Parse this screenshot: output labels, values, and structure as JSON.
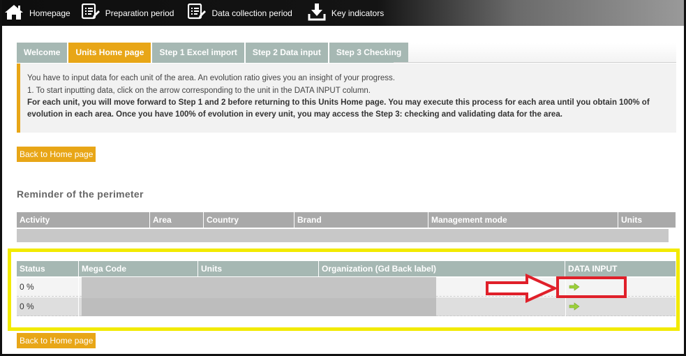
{
  "nav": {
    "items": [
      {
        "label": "Homepage",
        "icon": "home-icon"
      },
      {
        "label": "Preparation period",
        "icon": "checklist-edit-icon"
      },
      {
        "label": "Data collection period",
        "icon": "checklist-edit-icon"
      },
      {
        "label": "Key indicators",
        "icon": "download-icon"
      }
    ]
  },
  "tabs": [
    {
      "label": "Welcome",
      "active": false
    },
    {
      "label": "Units Home page",
      "active": true
    },
    {
      "label": "Step 1 Excel import",
      "active": false
    },
    {
      "label": "Step 2 Data input",
      "active": false
    },
    {
      "label": "Step 3 Checking",
      "active": false
    }
  ],
  "info": {
    "line1": "You have to input data for each unit of the area. An evolution ratio gives you an insight of your progress.",
    "line2": "1. To start inputting data, click on the arrow corresponding to the unit in the DATA INPUT column.",
    "line3": "For each unit, you will move forward to Step 1 and 2 before returning to this Units Home page. You may execute this process for each area until you obtain 100% of evolution in each area. Once you have 100% of evolution in every unit, you may access the Step 3: checking and validating data for the area."
  },
  "back_button_label": "Back to Home page",
  "reminder_title": "Reminder of the perimeter",
  "perimeter_table": {
    "headers": [
      "Activity",
      "Area",
      "Country",
      "Brand",
      "Management mode",
      "Units"
    ]
  },
  "units_table": {
    "headers": [
      "Status",
      "Mega Code",
      "Units",
      "Organization (Gd Back label)",
      "DATA INPUT"
    ],
    "rows": [
      {
        "status": "0 %",
        "mega_code": "("
      },
      {
        "status": "0 %",
        "mega_code": "("
      }
    ]
  },
  "colors": {
    "accent_orange": "#e8a617",
    "tab_inactive": "#a6b8b3",
    "highlight_yellow": "#f2ea00",
    "annotation_red": "#e0202a",
    "go_arrow_green": "#9bcf3a"
  }
}
